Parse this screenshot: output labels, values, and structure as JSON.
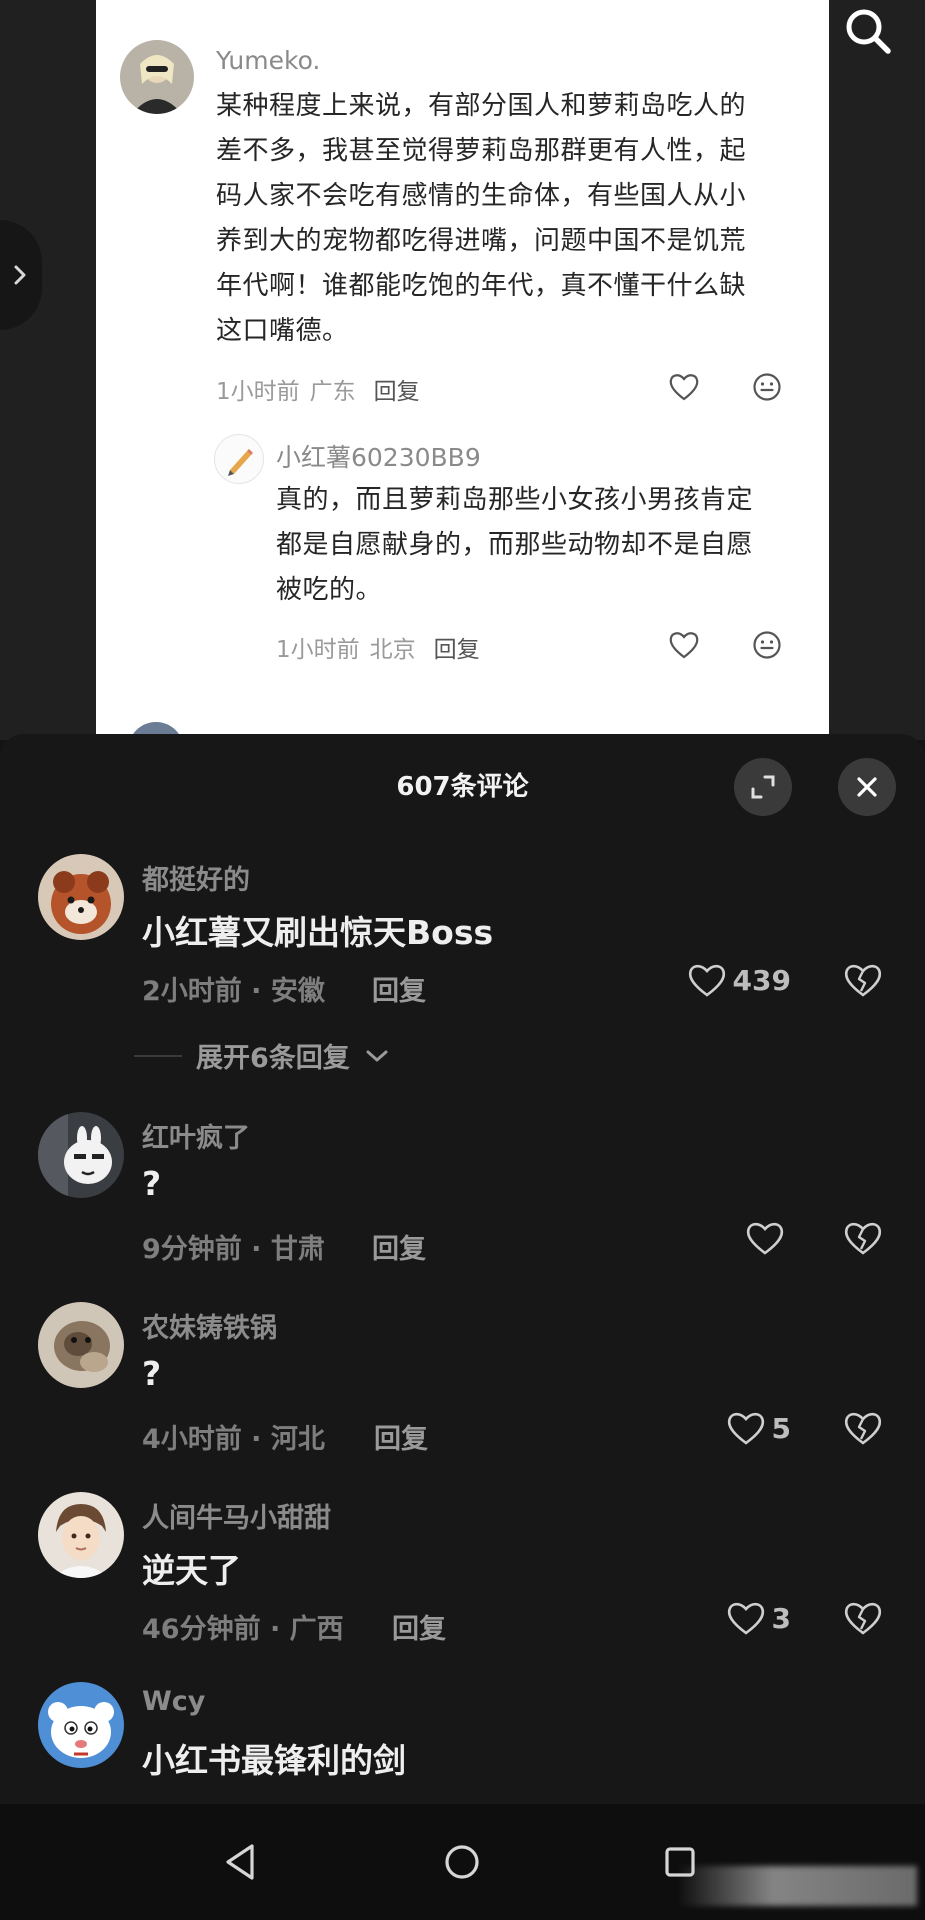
{
  "post": {
    "comment": {
      "username": "Yumeko.",
      "text_lines": [
        "某种程度上来说，有部分国人和萝莉岛吃人的",
        "差不多，我甚至觉得萝莉岛那群更有人性，起",
        "码人家不会吃有感情的生命体，有些国人从小",
        "养到大的宠物都吃得进嘴，问题中国不是饥荒",
        "年代啊！谁都能吃饱的年代，真不懂干什么缺",
        "这口嘴德。"
      ],
      "time": "1小时前",
      "location": "广东",
      "reply_label": "回复"
    },
    "reply": {
      "username": "小红薯60230BB9",
      "text_lines": [
        "真的，而且萝莉岛那些小女孩小男孩肯定",
        "都是自愿献身的，而那些动物却不是自愿",
        "被吃的。"
      ],
      "time": "1小时前",
      "location": "北京",
      "reply_label": "回复"
    }
  },
  "sheet": {
    "title": "607条评论",
    "comments": [
      {
        "username": "都挺好的",
        "text": "小红薯又刷出惊天Boss",
        "meta": "2小时前 · 安徽",
        "reply_label": "回复",
        "likes": "439"
      },
      {
        "username": "红叶疯了",
        "text": "?",
        "meta": "9分钟前 · 甘肃",
        "reply_label": "回复",
        "likes": ""
      },
      {
        "username": "农妹铸铁锅",
        "text": "?",
        "meta": "4小时前 · 河北",
        "reply_label": "回复",
        "likes": "5"
      },
      {
        "username": "人间牛马小甜甜",
        "text": "逆天了",
        "meta": "46分钟前 · 广西",
        "reply_label": "回复",
        "likes": "3"
      },
      {
        "username": "Wcy",
        "text": "小红书最锋利的剑",
        "meta": "",
        "reply_label": "",
        "likes": ""
      }
    ],
    "expand_label": "展开6条回复"
  },
  "icons": {
    "search": "search-icon",
    "expand": "expand-icon",
    "close": "close-icon",
    "like": "heart-icon",
    "dislike": "broken-heart-icon",
    "emoji": "smile-icon",
    "back": "back-triangle-icon",
    "home": "home-circle-icon",
    "recents": "recents-square-icon"
  },
  "colors": {
    "sheet_bg": "#171717",
    "post_bg": "#ffffff",
    "text_primary": "#eeeeee",
    "text_secondary": "#8b8b8b"
  }
}
